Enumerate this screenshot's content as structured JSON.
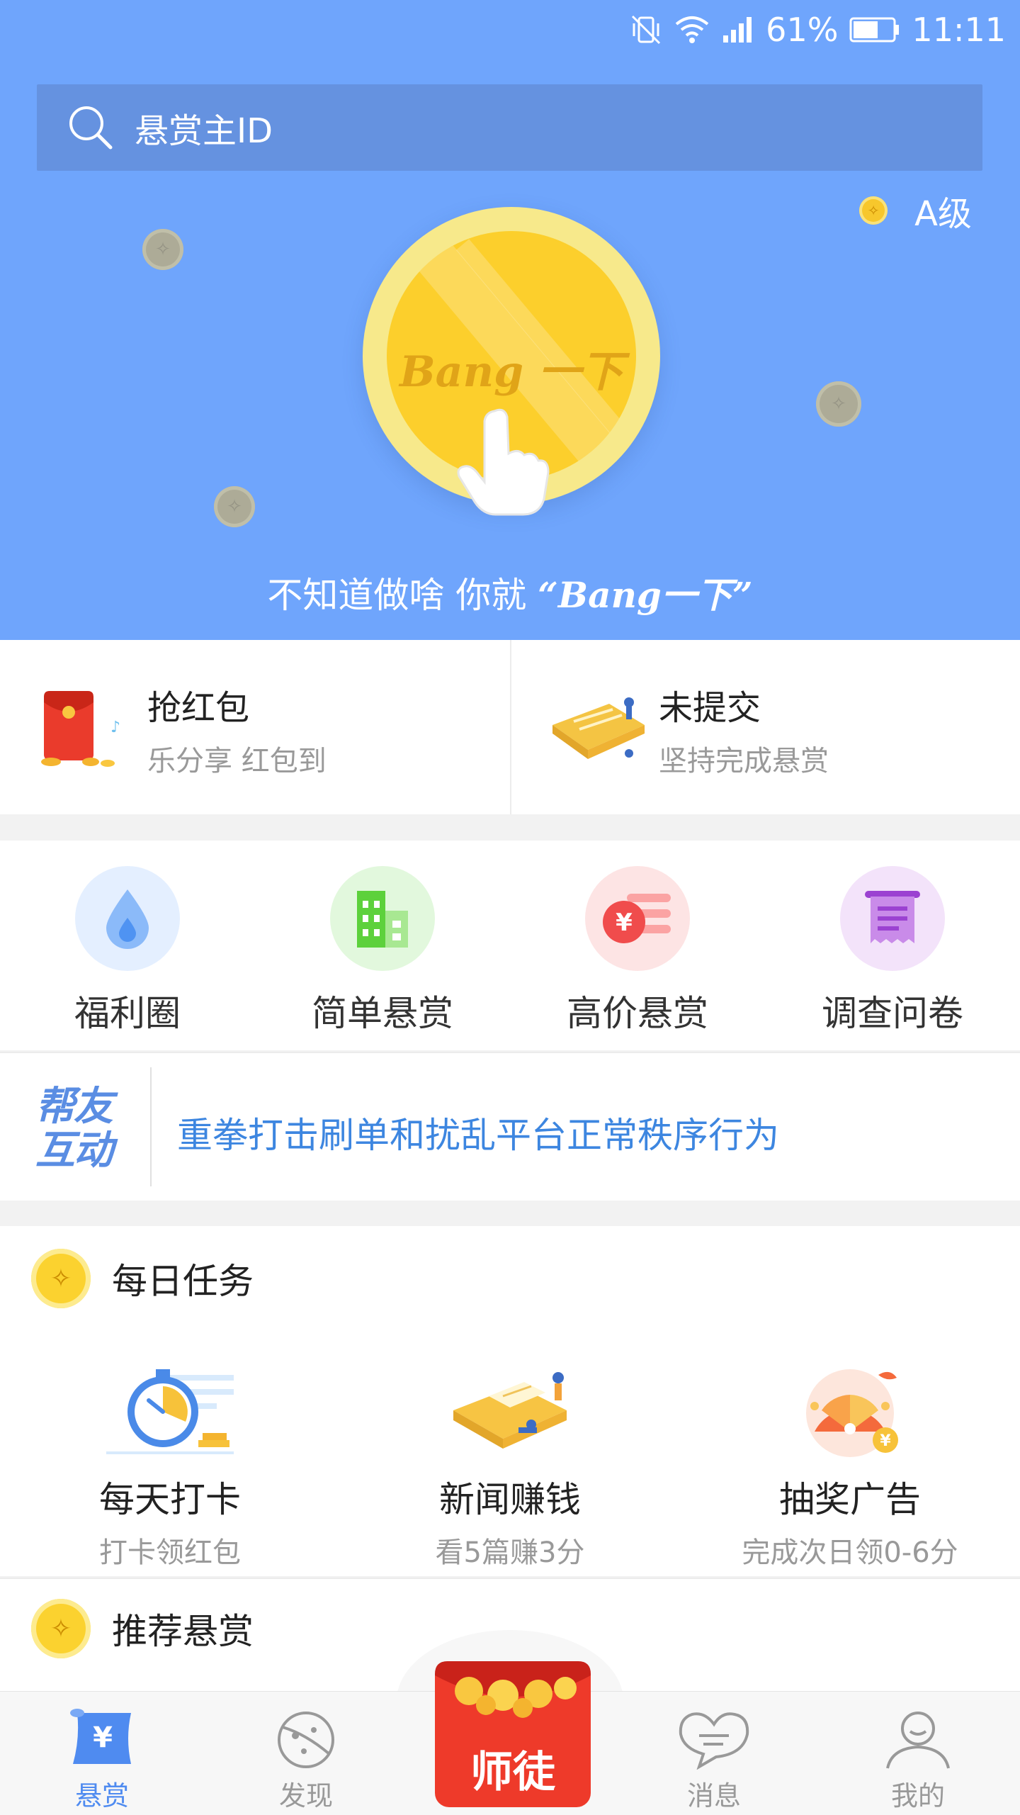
{
  "status_bar": {
    "battery": "61%",
    "time": "11:11"
  },
  "search": {
    "placeholder": "悬赏主ID"
  },
  "hero": {
    "level": "A级",
    "coin_label": "Bang 一下",
    "slogan_prefix": "不知道做啥 你就",
    "slogan_brand": "“Bang一下”"
  },
  "quick_cards": [
    {
      "title": "抢红包",
      "subtitle": "乐分享 红包到"
    },
    {
      "title": "未提交",
      "subtitle": "坚持完成悬赏"
    }
  ],
  "categories": [
    {
      "label": "福利圈",
      "icon": "water-drop-icon",
      "color": "#5ea3f7"
    },
    {
      "label": "简单悬赏",
      "icon": "buildings-icon",
      "color": "#62d243"
    },
    {
      "label": "高价悬赏",
      "icon": "yen-coin-icon",
      "color": "#f25a5a"
    },
    {
      "label": "调查问卷",
      "icon": "scroll-icon",
      "color": "#b66ae0"
    }
  ],
  "notice": {
    "logo_line1": "帮友",
    "logo_line2": "互动",
    "text": "重拳打击刷单和扰乱平台正常秩序行为"
  },
  "daily_tasks": {
    "title": "每日任务",
    "items": [
      {
        "title": "每天打卡",
        "subtitle": "打卡领红包",
        "icon": "stopwatch-icon"
      },
      {
        "title": "新闻赚钱",
        "subtitle": "看5篇赚3分",
        "icon": "newspaper-icon"
      },
      {
        "title": "抽奖广告",
        "subtitle": "完成次日领0-6分",
        "icon": "lottery-wheel-icon"
      }
    ]
  },
  "recommended": {
    "title": "推荐悬赏"
  },
  "bottom_nav": {
    "items": [
      {
        "label": "悬赏",
        "icon": "bounty-scroll-icon",
        "active": true
      },
      {
        "label": "发现",
        "icon": "planet-icon",
        "active": false
      },
      {
        "label": "师徒",
        "icon": "red-envelope-icon",
        "active": false
      },
      {
        "label": "消息",
        "icon": "chat-heart-icon",
        "active": false
      },
      {
        "label": "我的",
        "icon": "person-icon",
        "active": false
      }
    ]
  }
}
